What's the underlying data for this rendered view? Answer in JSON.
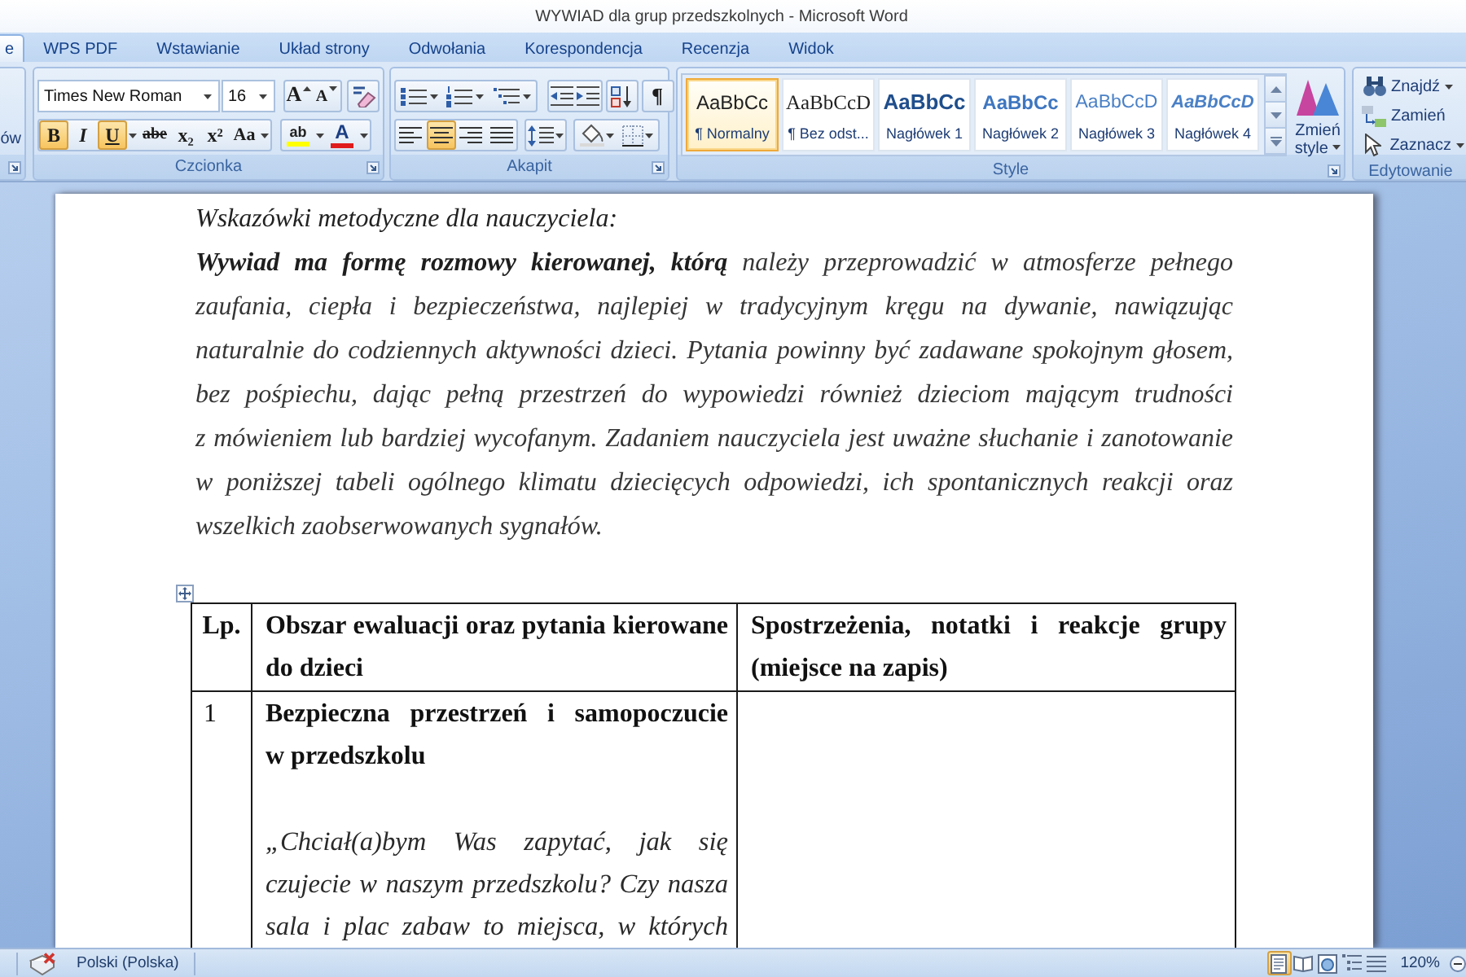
{
  "window": {
    "title": "WYWIAD dla grup przedszkolnych - Microsoft Word"
  },
  "tabs": [
    {
      "label": "e",
      "selected": true
    },
    {
      "label": "WPS PDF",
      "selected": false
    },
    {
      "label": "Wstawianie",
      "selected": false
    },
    {
      "label": "Układ strony",
      "selected": false
    },
    {
      "label": "Odwołania",
      "selected": false
    },
    {
      "label": "Korespondencja",
      "selected": false
    },
    {
      "label": "Recenzja",
      "selected": false
    },
    {
      "label": "Widok",
      "selected": false
    }
  ],
  "ribbon": {
    "clipboard_fragment": {
      "button_label": "ów"
    },
    "font_group": {
      "title": "Czcionka",
      "font_name": "Times New Roman",
      "font_size": "16",
      "size_buttons": [
        {
          "kind": "grow",
          "glyph": "A"
        },
        {
          "kind": "shrink",
          "glyph": "A"
        }
      ],
      "format_buttons": [
        {
          "kind": "bold",
          "glyph": "B",
          "on": true
        },
        {
          "kind": "italic",
          "glyph": "I",
          "on": false
        },
        {
          "kind": "underline",
          "glyph": "U",
          "on": true
        },
        {
          "kind": "strikethrough",
          "glyph": "abe",
          "on": false
        },
        {
          "kind": "subscript",
          "glyph": "x₂",
          "on": false
        },
        {
          "kind": "superscript",
          "glyph": "x²",
          "on": false
        },
        {
          "kind": "change-case",
          "glyph": "Aa",
          "on": false
        }
      ],
      "color_buttons": [
        {
          "kind": "highlight",
          "glyph": "ab"
        },
        {
          "kind": "font-color",
          "glyph": "A"
        }
      ]
    },
    "paragraph_group": {
      "title": "Akapit",
      "alignment": [
        {
          "kind": "left",
          "selected": false
        },
        {
          "kind": "center",
          "selected": true
        },
        {
          "kind": "right",
          "selected": false
        },
        {
          "kind": "justify",
          "selected": false
        }
      ],
      "show_marks": {
        "glyph": "¶",
        "on": false
      }
    },
    "style_group": {
      "title": "Style",
      "styles": [
        {
          "kind": "normal",
          "preview": "AaBbCc",
          "label": "¶ Normalny",
          "selected": true
        },
        {
          "kind": "no-spacing",
          "preview": "AaBbCcD",
          "label": "¶ Bez odst...",
          "selected": false
        },
        {
          "kind": "heading1",
          "preview": "AaBbCc",
          "label": "Nagłówek 1",
          "selected": false
        },
        {
          "kind": "heading2",
          "preview": "AaBbCc",
          "label": "Nagłówek 2",
          "selected": false
        },
        {
          "kind": "heading3",
          "preview": "AaBbCcD",
          "label": "Nagłówek 3",
          "selected": false
        },
        {
          "kind": "heading4",
          "preview": "AaBbCcD",
          "label": "Nagłówek 4",
          "selected": false
        }
      ],
      "change_styles_label": "Zmień style"
    },
    "editing_group": {
      "title": "Edytowanie",
      "commands": [
        {
          "kind": "find",
          "label": "Znajdź",
          "dropdown": true
        },
        {
          "kind": "replace",
          "label": "Zamień",
          "dropdown": false
        },
        {
          "kind": "select",
          "label": "Zaznacz",
          "dropdown": true
        }
      ]
    }
  },
  "document": {
    "heading": "Wskazówki metodyczne dla nauczyciela:",
    "paragraph": "**Wywiad ma formę rozmowy kierowanej, którą** należy przeprowadzić w atmosferze pełnego zaufania, ciepła i bezpieczeństwa, najlepiej w tradycyjnym kręgu na dywanie, nawiązując naturalnie do codziennych aktywności dzieci. Pytania powinny być zadawane spokojnym głosem, bez pośpiechu, dając pełną przestrzeń do wypowiedzi również dzieciom mającym trudności z mówieniem lub bardziej wycofanym. Zadaniem nauczyciela jest uważne słuchanie i zanotowanie w poniższej tabeli ogólnego klimatu dziecięcych odpowiedzi, ich spontanicznych reakcji oraz wszelkich zaobserwowanych sygnałów.",
    "table": {
      "columns": [
        "Lp.",
        "Obszar ewaluacji oraz pytania kierowane do dzieci",
        "Spostrzeżenia, notatki i reakcje grupy (miejsce na zapis)"
      ],
      "rows": [
        {
          "number": "1",
          "title": "Bezpieczna przestrzeń i samopoczucie w przedszkolu",
          "question": "„Chciał(a)bym Was zapytać, jak się czujecie w naszym przedszkolu? Czy nasza sala i plac zabaw to miejsca, w których"
        }
      ]
    }
  },
  "status_bar": {
    "language": "Polski (Polska)",
    "views": [
      {
        "kind": "print-layout",
        "selected": true
      },
      {
        "kind": "full-screen-reading",
        "selected": false
      },
      {
        "kind": "web-layout",
        "selected": false
      },
      {
        "kind": "outline",
        "selected": false
      },
      {
        "kind": "draft",
        "selected": false
      }
    ],
    "zoom": "120%"
  }
}
